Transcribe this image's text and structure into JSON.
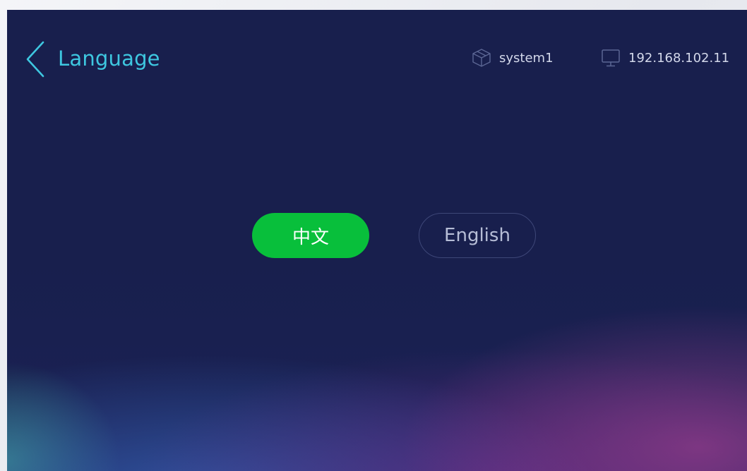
{
  "header": {
    "back_icon": "chevron-left-icon",
    "title": "Language",
    "title_color": "#3ec7e0"
  },
  "status_bar": {
    "system_icon": "cube-icon",
    "system_name": "system1",
    "ip_icon": "monitor-icon",
    "ip_address": "192.168.102.11"
  },
  "languages": {
    "options": [
      {
        "label": "中文",
        "selected": true
      },
      {
        "label": "English",
        "selected": false
      }
    ],
    "selected_color": "#08bf3b"
  },
  "colors": {
    "background": "#181f4d",
    "accent": "#3ec7e0"
  }
}
